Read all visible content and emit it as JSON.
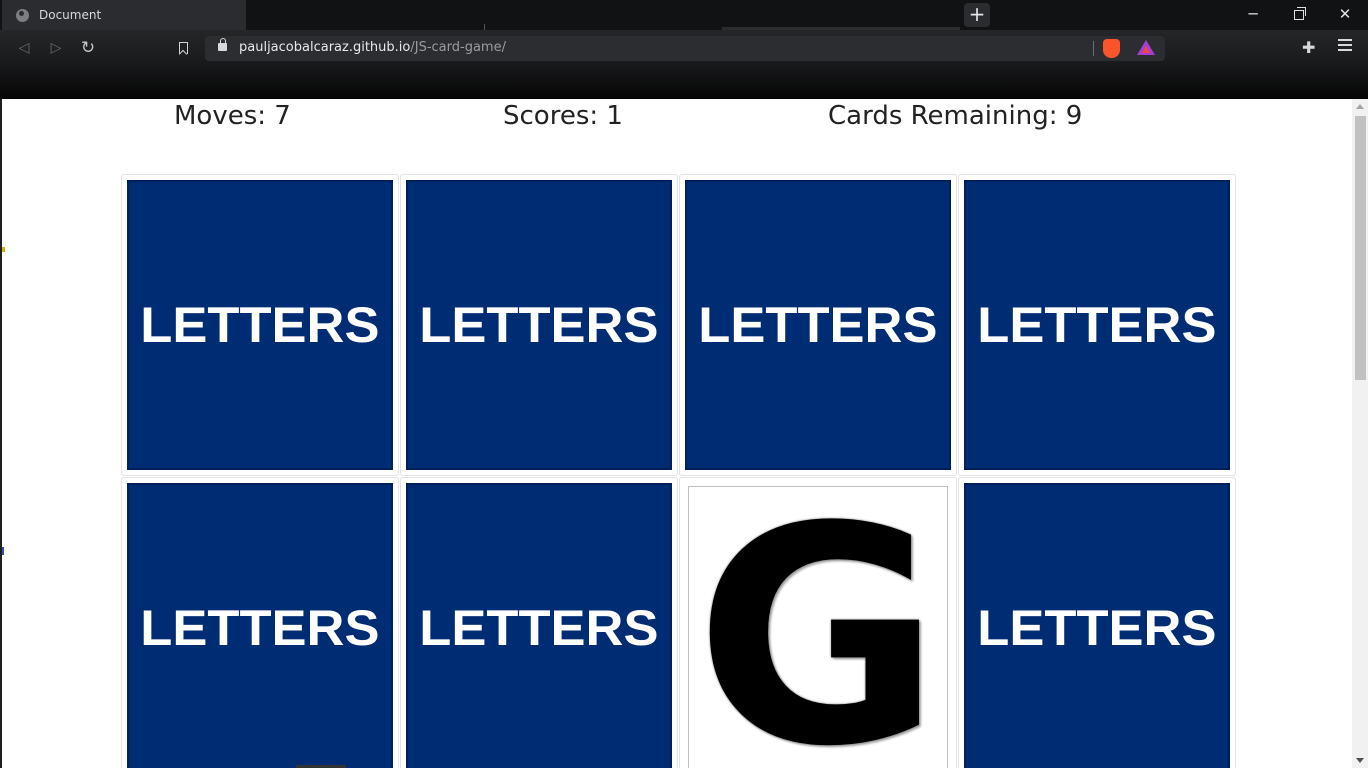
{
  "browser": {
    "tab_title": "Document",
    "new_tab_symbol": "+",
    "url_host": "pauljacobalcaraz.github.io",
    "url_path": "/JS-card-game/",
    "window_controls": {
      "minimize": "─",
      "close": "✕"
    },
    "icons": [
      "globe-icon",
      "back-icon",
      "forward-icon",
      "reload-icon",
      "bookmark-icon",
      "lock-icon",
      "brave-shields-icon",
      "brave-rewards-icon",
      "extensions-icon",
      "menu-icon"
    ]
  },
  "game": {
    "moves_text": "Moves: 7",
    "scores_text": "Scores: 1",
    "remaining_text": "Cards Remaining: 9",
    "card_back_label": "LETTERS",
    "cards": [
      {
        "state": "face-down",
        "label": "LETTERS"
      },
      {
        "state": "face-down",
        "label": "LETTERS"
      },
      {
        "state": "face-down",
        "label": "LETTERS"
      },
      {
        "state": "face-down",
        "label": "LETTERS"
      },
      {
        "state": "face-down",
        "label": "LETTERS"
      },
      {
        "state": "face-down",
        "label": "LETTERS"
      },
      {
        "state": "face-up",
        "label": "G"
      },
      {
        "state": "face-down",
        "label": "LETTERS"
      }
    ],
    "colors": {
      "card_back": "#002c73",
      "card_text": "#ffffff",
      "letter": "#000000"
    }
  }
}
